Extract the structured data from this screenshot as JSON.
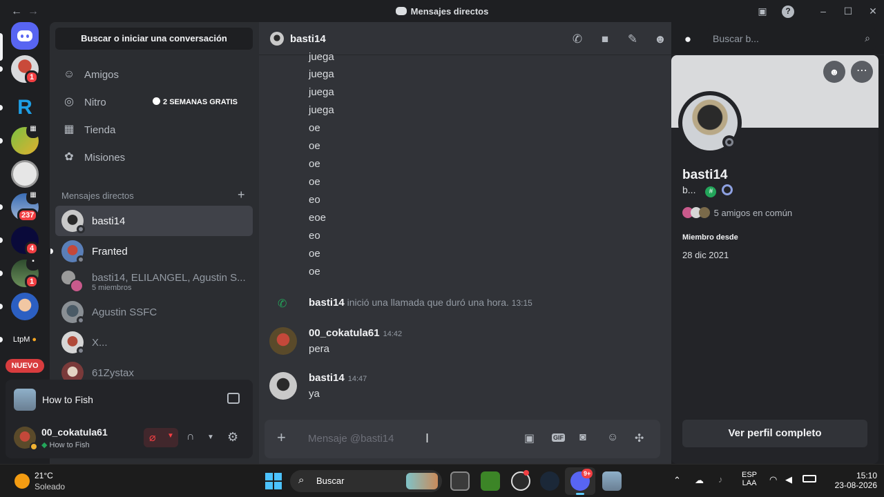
{
  "window": {
    "title": "Mensajes directos"
  },
  "rail": {
    "badges": [
      "1",
      "237",
      "4",
      "1"
    ],
    "text_server": "LtpM",
    "new_label": "NUEVO"
  },
  "sidebar": {
    "search_label": "Buscar o iniciar una conversación",
    "nav": [
      {
        "label": "Amigos",
        "icon": "friends-icon"
      },
      {
        "label": "Nitro",
        "icon": "nitro-icon",
        "badge": "2 SEMANAS GRATIS"
      },
      {
        "label": "Tienda",
        "icon": "shop-icon"
      },
      {
        "label": "Misiones",
        "icon": "quests-icon"
      }
    ],
    "dm_header": "Mensajes directos",
    "dms": [
      {
        "name": "basti14"
      },
      {
        "name": "Franted"
      },
      {
        "name": "basti14, ELILANGEL, Agustin S...",
        "sub": "5 miembros"
      },
      {
        "name": "Agustin SSFC"
      },
      {
        "name": "X..."
      },
      {
        "name": "61Zystax"
      }
    ]
  },
  "activity": {
    "game": "How to Fish"
  },
  "user": {
    "name": "00_cokatula61",
    "status": "How to Fish"
  },
  "chat": {
    "channel": "basti14",
    "search_placeholder": "Buscar b...",
    "lines": [
      "juega",
      "juega",
      "juega",
      "juega",
      "oe",
      "oe",
      "oe",
      "oe",
      "eo",
      "eoe",
      "eo",
      "oe",
      "oe"
    ],
    "call": {
      "author": "basti14",
      "text": "inició una llamada que duró una hora.",
      "time": "13:15"
    },
    "messages": [
      {
        "author": "00_cokatula61",
        "time": "14:42",
        "text": "pera"
      },
      {
        "author": "basti14",
        "time": "14:47",
        "text": "ya"
      }
    ],
    "composer_placeholder": "Mensaje @basti14"
  },
  "profile": {
    "name": "basti14",
    "pronoun_short": "b...",
    "mutual_friends": "5 amigos en común",
    "member_since_label": "Miembro desde",
    "member_since": "28 dic 2021",
    "full_profile_button": "Ver perfil completo"
  },
  "taskbar": {
    "weather_temp": "21°C",
    "weather_desc": "Soleado",
    "search_label": "Buscar",
    "lang_1": "ESP",
    "lang_2": "LAA",
    "time": "15:10",
    "date": "23-08-2026",
    "discord_badge": "9+"
  },
  "colors": {
    "accent": "#5865f2",
    "danger": "#f23f43",
    "online_green": "#23a55a"
  }
}
